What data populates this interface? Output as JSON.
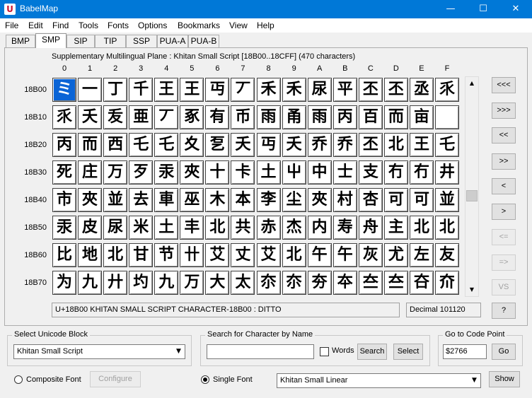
{
  "window": {
    "title": "BabelMap",
    "icon_label": "U",
    "minimize": "—",
    "maximize": "☐",
    "close": "✕"
  },
  "menu": [
    "File",
    "Edit",
    "Find",
    "Tools",
    "Fonts",
    "Options",
    "Bookmarks",
    "View",
    "Help"
  ],
  "tabs": [
    "BMP",
    "SMP",
    "SIP",
    "TIP",
    "SSP",
    "PUA-A",
    "PUA-B"
  ],
  "active_tab": "SMP",
  "block_title": "Supplementary Multilingual Plane : Khitan Small Script [18B00..18CFF] (470 characters)",
  "grid": {
    "columns": [
      "0",
      "1",
      "2",
      "3",
      "4",
      "5",
      "6",
      "7",
      "8",
      "9",
      "A",
      "B",
      "C",
      "D",
      "E",
      "F"
    ],
    "rows": [
      {
        "label": "18B00",
        "chars": [
          "ミ",
          "一",
          "丁",
          "千",
          "王",
          "王",
          "丏",
          "丆",
          "禾",
          "禾",
          "尿",
          "平",
          "丕",
          "丕",
          "丞",
          "乑"
        ]
      },
      {
        "label": "18B10",
        "chars": [
          "乑",
          "夭",
          "叐",
          "亜",
          "丆",
          "豖",
          "有",
          "币",
          "雨",
          "甬",
          "雨",
          "丙",
          "百",
          "而",
          "亩"
        ]
      },
      {
        "label": "18B20",
        "chars": [
          "丙",
          "而",
          "西",
          "乇",
          "乇",
          "夊",
          "乭",
          "夭",
          "丏",
          "夭",
          "乔",
          "乔",
          "丕",
          "北",
          "王",
          "乇"
        ]
      },
      {
        "label": "18B30",
        "chars": [
          "死",
          "庄",
          "万",
          "歹",
          "汞",
          "夾",
          "十",
          "卡",
          "土",
          "屮",
          "中",
          "士",
          "支",
          "冇",
          "冇",
          "井"
        ]
      },
      {
        "label": "18B40",
        "chars": [
          "市",
          "夾",
          "並",
          "去",
          "車",
          "巫",
          "木",
          "本",
          "李",
          "尘",
          "夾",
          "村",
          "杏",
          "可",
          "可",
          "並"
        ]
      },
      {
        "label": "18B50",
        "chars": [
          "汞",
          "皮",
          "尿",
          "米",
          "土",
          "丰",
          "北",
          "共",
          "赤",
          "杰",
          "内",
          "寿",
          "舟",
          "主",
          "北",
          "北"
        ]
      },
      {
        "label": "18B60",
        "chars": [
          "比",
          "地",
          "北",
          "甘",
          "节",
          "卄",
          "艾",
          "丈",
          "艾",
          "北",
          "午",
          "午",
          "灰",
          "尤",
          "左",
          "友"
        ]
      },
      {
        "label": "18B70",
        "chars": [
          "为",
          "九",
          "廾",
          "圴",
          "九",
          "万",
          "大",
          "太",
          "夵",
          "夵",
          "夯",
          "夲",
          "夳",
          "夳",
          "夻",
          "夼"
        ]
      }
    ],
    "selected": {
      "row": 0,
      "col": 0
    }
  },
  "scroll": {
    "up": "▲",
    "down": "▼"
  },
  "nav_buttons": [
    "<<<",
    ">>>",
    "<<",
    ">>",
    "<",
    ">",
    "<=",
    "=>",
    "VS",
    "?"
  ],
  "status": {
    "description": "U+18B00 KHITAN SMALL SCRIPT CHARACTER-18B00 : DITTO",
    "decimal": "Decimal 101120"
  },
  "select_block": {
    "label": "Select Unicode Block",
    "value": "Khitan Small Script"
  },
  "search": {
    "label": "Search for Character by Name",
    "value": "",
    "words_label": "Words",
    "search_btn": "Search",
    "select_btn": "Select"
  },
  "goto": {
    "label": "Go to Code Point",
    "value": "$2766",
    "go_btn": "Go"
  },
  "font_mode": {
    "composite_label": "Composite Font",
    "configure_btn": "Configure",
    "single_label": "Single Font",
    "font_value": "Khitan Small Linear",
    "show_btn": "Show"
  },
  "combo_arrow": "▼"
}
